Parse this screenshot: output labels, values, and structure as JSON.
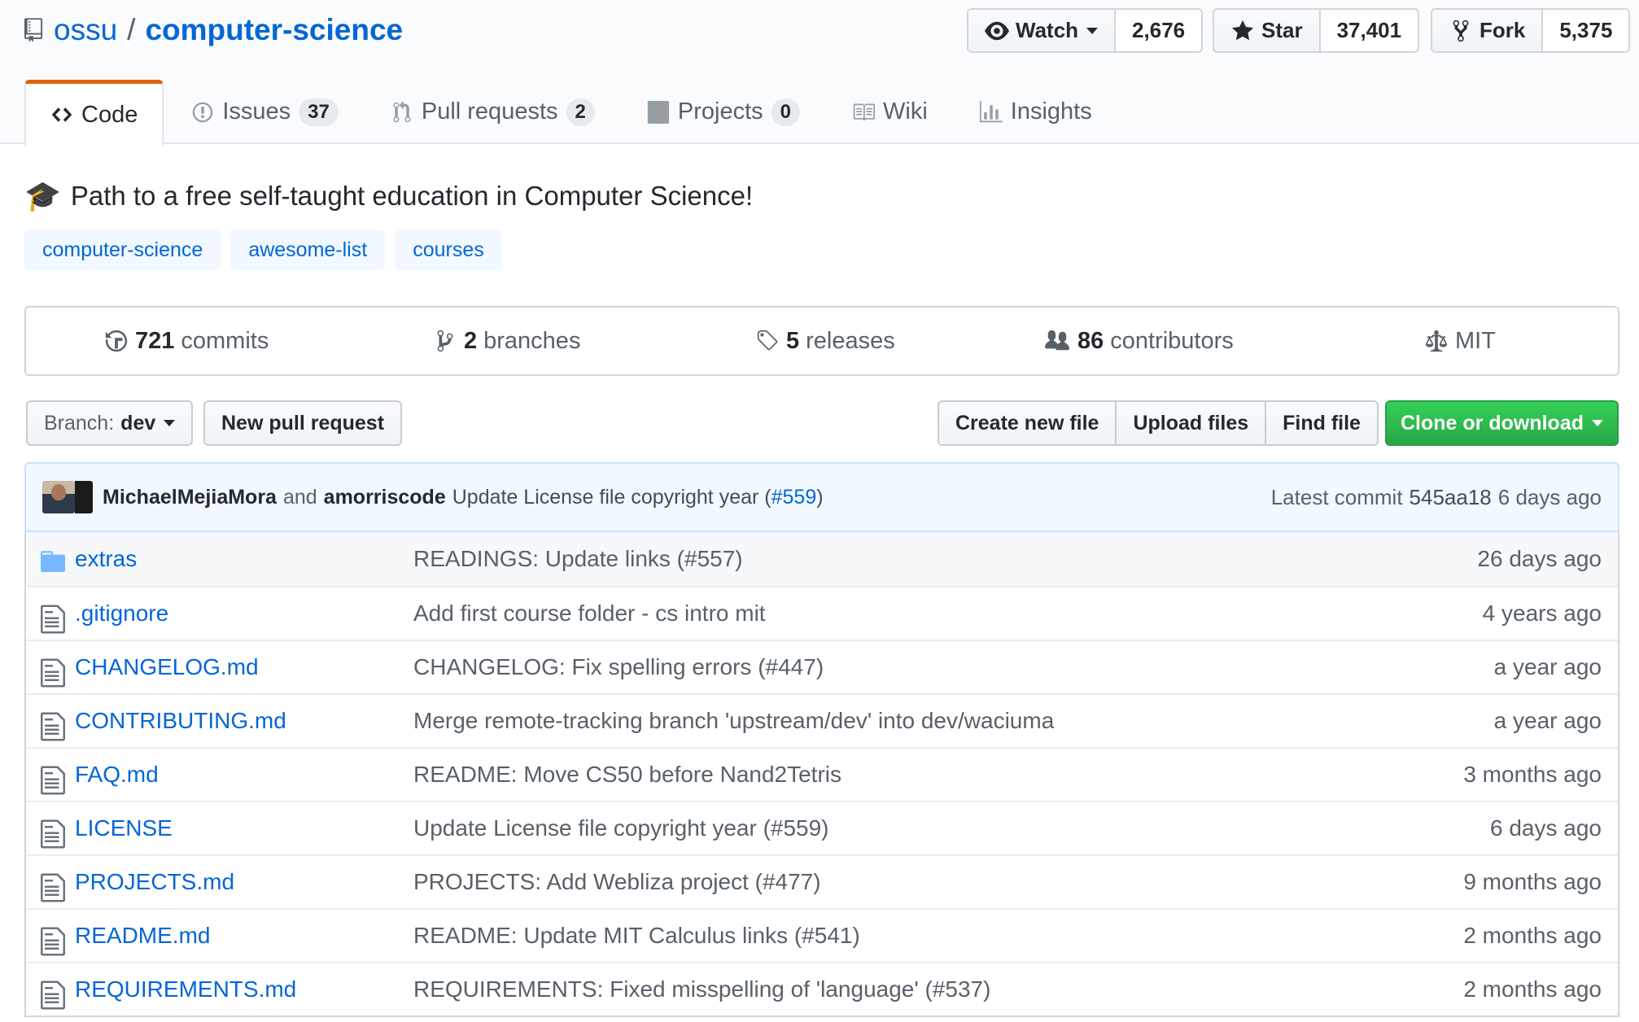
{
  "repo": {
    "owner": "ossu",
    "separator": "/",
    "name": "computer-science"
  },
  "social": {
    "watch": {
      "label": "Watch",
      "count": "2,676"
    },
    "star": {
      "label": "Star",
      "count": "37,401"
    },
    "fork": {
      "label": "Fork",
      "count": "5,375"
    }
  },
  "tabs": [
    {
      "label": "Code",
      "icon": "code-icon",
      "active": true
    },
    {
      "label": "Issues",
      "icon": "issue-icon",
      "count": "37"
    },
    {
      "label": "Pull requests",
      "icon": "pull-request-icon",
      "count": "2"
    },
    {
      "label": "Projects",
      "icon": "project-icon",
      "count": "0"
    },
    {
      "label": "Wiki",
      "icon": "book-icon"
    },
    {
      "label": "Insights",
      "icon": "graph-icon"
    }
  ],
  "description": {
    "emoji": "🎓",
    "text": "Path to a free self-taught education in Computer Science!"
  },
  "topics": [
    "computer-science",
    "awesome-list",
    "courses"
  ],
  "summary": {
    "commits": {
      "num": "721",
      "label": "commits"
    },
    "branches": {
      "num": "2",
      "label": "branches"
    },
    "releases": {
      "num": "5",
      "label": "releases"
    },
    "contributors": {
      "num": "86",
      "label": "contributors"
    },
    "license": {
      "label": "MIT"
    }
  },
  "actions": {
    "branch_label": "Branch:",
    "branch_value": "dev",
    "new_pr": "New pull request",
    "create_file": "Create new file",
    "upload_files": "Upload files",
    "find_file": "Find file",
    "clone": "Clone or download"
  },
  "commit": {
    "author1": "MichaelMejiaMora",
    "and": "and",
    "author2": "amorriscode",
    "message": "Update License file copyright year (",
    "pr_link": "#559",
    "message_end": ")",
    "latest_label": "Latest commit",
    "sha": "545aa18",
    "age": "6 days ago"
  },
  "files": [
    {
      "type": "dir",
      "name": "extras",
      "message": "READINGS: Update links (#557)",
      "age": "26 days ago"
    },
    {
      "type": "file",
      "name": ".gitignore",
      "message": "Add first course folder - cs intro mit",
      "age": "4 years ago"
    },
    {
      "type": "file",
      "name": "CHANGELOG.md",
      "message": "CHANGELOG: Fix spelling errors (#447)",
      "age": "a year ago"
    },
    {
      "type": "file",
      "name": "CONTRIBUTING.md",
      "message": "Merge remote-tracking branch 'upstream/dev' into dev/waciuma",
      "age": "a year ago"
    },
    {
      "type": "file",
      "name": "FAQ.md",
      "message": "README: Move CS50 before Nand2Tetris",
      "age": "3 months ago"
    },
    {
      "type": "file",
      "name": "LICENSE",
      "message": "Update License file copyright year (#559)",
      "age": "6 days ago"
    },
    {
      "type": "file",
      "name": "PROJECTS.md",
      "message": "PROJECTS: Add Webliza project (#477)",
      "age": "9 months ago"
    },
    {
      "type": "file",
      "name": "README.md",
      "message": "README: Update MIT Calculus links (#541)",
      "age": "2 months ago"
    },
    {
      "type": "file",
      "name": "REQUIREMENTS.md",
      "message": "REQUIREMENTS: Fixed misspelling of 'language' (#537)",
      "age": "2 months ago"
    }
  ],
  "colors": {
    "link": "#0366d6",
    "active_tab": "#e36209",
    "clone_green": "#28a745",
    "commit_bg": "#f1f8ff"
  }
}
